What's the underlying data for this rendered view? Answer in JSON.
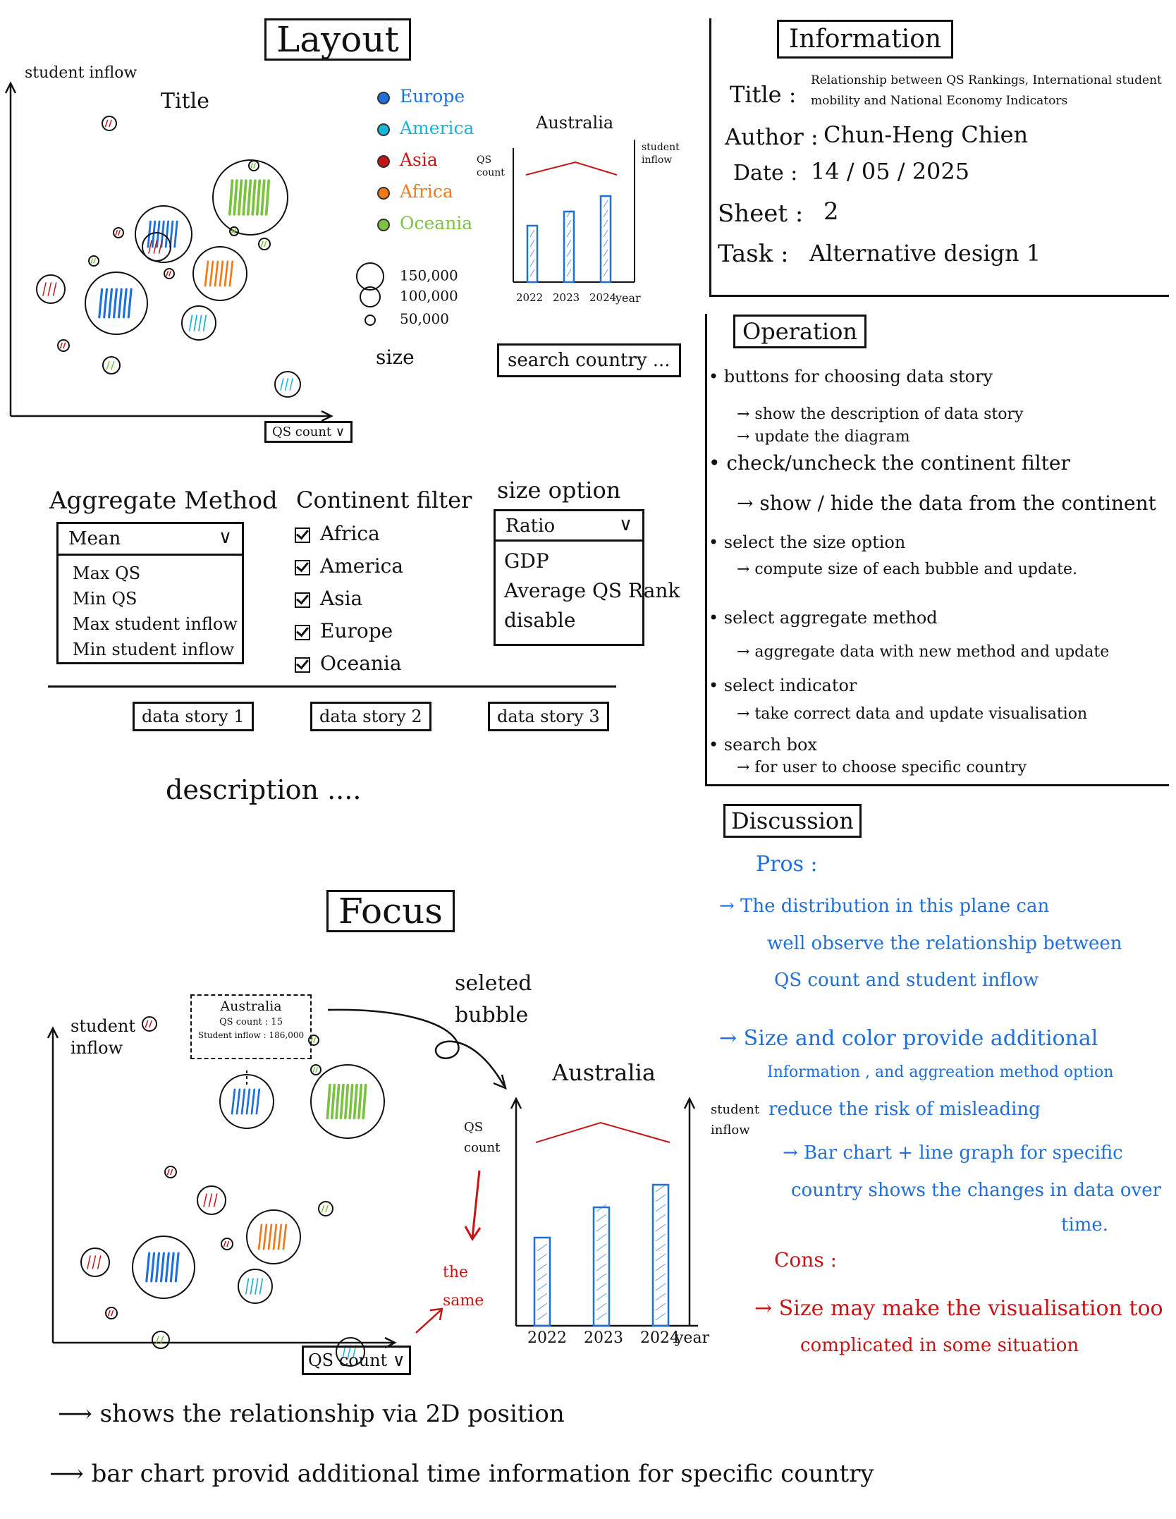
{
  "layout": {
    "title": "Layout",
    "y_axis_label": "student inflow",
    "chart_title": "Title",
    "x_axis_select": "QS count",
    "legend": [
      {
        "label": "Europe",
        "color": "#1e6fd9"
      },
      {
        "label": "America",
        "color": "#18b4d9"
      },
      {
        "label": "Asia",
        "color": "#c41414"
      },
      {
        "label": "Africa",
        "color": "#f07a1a"
      },
      {
        "label": "Oceania",
        "color": "#7cc242"
      }
    ],
    "size_legend": [
      "150,000",
      "100,000",
      "50,000"
    ],
    "size_label": "size",
    "search_placeholder": "search country ..."
  },
  "mini_chart": {
    "title": "Australia",
    "left_label": "QS count",
    "right_label": "student inflow",
    "x_ticks": [
      "2022",
      "2023",
      "2024"
    ],
    "x_unit": "year"
  },
  "controls": {
    "aggregate_title": "Aggregate Method",
    "aggregate_selected": "Mean",
    "aggregate_options": [
      "Max QS",
      "Min QS",
      "Max student inflow",
      "Min student inflow"
    ],
    "continent_title": "Continent filter",
    "continents": [
      "Africa",
      "America",
      "Asia",
      "Europe",
      "Oceania"
    ],
    "size_title": "size option",
    "size_selected": "Ratio",
    "size_options": [
      "GDP",
      "Average QS Rank",
      "disable"
    ],
    "stories": [
      "data story 1",
      "data story 2",
      "data story 3"
    ],
    "description": "description ...."
  },
  "focus": {
    "title": "Focus",
    "y_axis_label": "student inflow",
    "tooltip": {
      "country": "Australia",
      "qs": "QS count : 15",
      "inflow": "Student inflow : 186,000"
    },
    "x_axis_select": "QS count",
    "selected_label": "seleted bubble",
    "same_label": "the same",
    "chart_title": "Australia",
    "left_label": "QS count",
    "right_label": "student inflow",
    "x_ticks": [
      "2022",
      "2023",
      "2024"
    ],
    "x_unit": "year"
  },
  "notes": [
    "shows the relationship via 2D position",
    "bar chart provid additional time information for specific country"
  ],
  "information": {
    "title": "Information",
    "rows": [
      {
        "key": "Title :",
        "value": "Relationship between QS Rankings, International student mobility and National Economy Indicators"
      },
      {
        "key": "Author :",
        "value": "Chun-Heng Chien"
      },
      {
        "key": "Date :",
        "value": "14 / 05 / 2025"
      },
      {
        "key": "Sheet :",
        "value": "2"
      },
      {
        "key": "Task :",
        "value": "Alternative design 1"
      }
    ]
  },
  "operation": {
    "title": "Operation",
    "lines": [
      "buttons for choosing data story",
      "→ show the description of data story",
      "→ update the diagram",
      "check/uncheck the continent filter",
      "→ show / hide the data from the continent",
      "select the size option",
      "→ compute size of each bubble and update.",
      "select aggregate method",
      "→ aggregate data with new method and update",
      "select indicator",
      "→ take correct data and update visualisation",
      "search box",
      "→ for user to choose specific country"
    ]
  },
  "discussion": {
    "title": "Discussion",
    "pros_label": "Pros :",
    "pros": [
      "→ The distribution in this plane can",
      "well observe the relationship between",
      "QS count and student inflow",
      "→ Size and color provide additional",
      "Information , and aggreation method option",
      "reduce the risk of misleading",
      "→ Bar chart + line graph for specific",
      "country shows the changes in data over",
      "time."
    ],
    "cons_label": "Cons :",
    "cons": [
      "→ Size may make the visualisation too",
      "complicated in some situation"
    ]
  }
}
